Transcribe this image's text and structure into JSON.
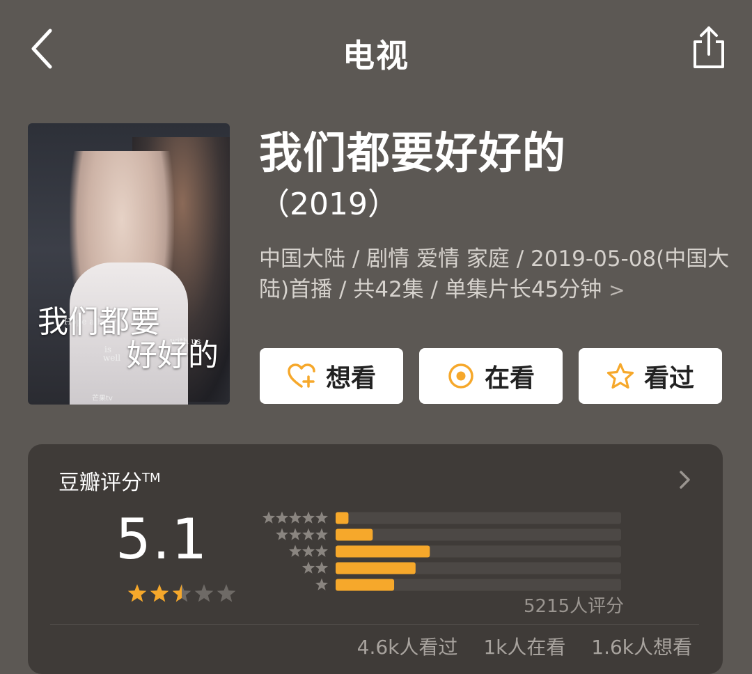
{
  "nav": {
    "title": "电视",
    "back_icon": "chevron-left-icon",
    "share_icon": "share-icon"
  },
  "poster": {
    "title_line1": "我们都要",
    "title_line2": "好好的",
    "english_1": "Hope all",
    "english_2": "is",
    "english_3": "well",
    "english_4": "with us",
    "logos": "芒果tv"
  },
  "show": {
    "name": "我们都要好好的",
    "year": "（2019）",
    "meta": "中国大陆 / 剧情 爱情 家庭 / 2019-05-08(中国大陆)首播 / 共42集 / 单集片长45分钟",
    "meta_chevron": ">"
  },
  "actions": {
    "want": "想看",
    "watching": "在看",
    "watched": "看过"
  },
  "rating": {
    "title": "豆瓣评分",
    "trademark": "TM",
    "score": "5.1",
    "stars": 2.5,
    "distribution": [
      {
        "stars": 5,
        "fraction": 0.045
      },
      {
        "stars": 4,
        "fraction": 0.13
      },
      {
        "stars": 3,
        "fraction": 0.33
      },
      {
        "stars": 2,
        "fraction": 0.28
      },
      {
        "stars": 1,
        "fraction": 0.205
      }
    ],
    "count": "5215人评分",
    "watched": "4.6k人看过",
    "watching": "1k人在看",
    "want": "1.6k人想看"
  },
  "colors": {
    "background": "#5c5854",
    "card": "#3f3b38",
    "accent": "#f6a82b",
    "bar_track": "#4c4845"
  }
}
